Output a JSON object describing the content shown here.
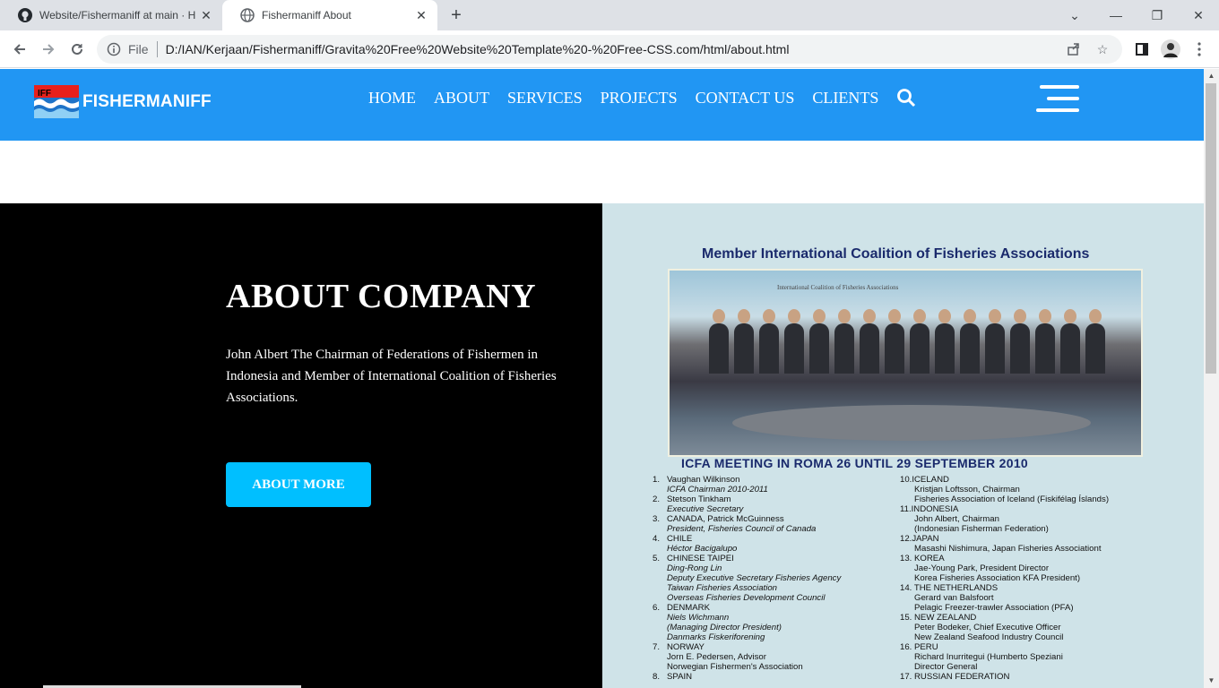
{
  "browser": {
    "tabs": [
      {
        "title": "Website/Fishermaniff at main · H",
        "active": false,
        "icon": "github-icon"
      },
      {
        "title": "Fishermaniff About",
        "active": true,
        "icon": "globe-icon"
      }
    ],
    "scheme_label": "File",
    "url": "D:/IAN/Kerjaan/Fishermaniff/Gravita%20Free%20Website%20Template%20-%20Free-CSS.com/html/about.html"
  },
  "site": {
    "brand": "FISHERMANIFF",
    "brand_colors": {
      "header": "#2196f3",
      "button": "#00bfff"
    },
    "nav": [
      "HOME",
      "ABOUT",
      "SERVICES",
      "PROJECTS",
      "CONTACT US",
      "CLIENTS"
    ]
  },
  "about": {
    "title": "ABOUT COMPANY",
    "text": "John Albert The Chairman of Federations of Fishermen in Indonesia and Member of International Coalition of Fisheries Associations.",
    "button": "ABOUT MORE"
  },
  "document": {
    "title": "Member International Coalition of Fisheries Associations",
    "banner": "International Coalition of Fisheries Associations",
    "subtitle": "ICFA MEETING IN ROMA 26 UNTIL 29 SEPTEMBER 2010",
    "left_col": [
      "1.   Vaughan Wilkinson",
      "      ICFA Chairman 2010-2011",
      "2.   Stetson Tinkham",
      "      Executive Secretary",
      "3.   CANADA, Patrick McGuinness",
      "      President, Fisheries Council of Canada",
      "4.   CHILE",
      "      Héctor Bacigalupo",
      "5.   CHINESE TAIPEI",
      "      Ding-Rong Lin",
      "      Deputy Executive Secretary Fisheries Agency",
      "      Taiwan Fisheries Association",
      "      Overseas Fisheries Development Council",
      "6.   DENMARK",
      "      Niels Wichmann",
      "      (Managing Director President)",
      "      Danmarks Fiskeriforening",
      "7.   NORWAY",
      "      Jorn E. Pedersen, Advisor",
      "      Norwegian Fishermen's Association",
      "8.   SPAIN"
    ],
    "right_col": [
      "10.ICELAND",
      "      Kristjan Loftsson, Chairman",
      "      Fisheries Association of Iceland (Fiskifélag Íslands)",
      "11.INDONESIA",
      "      John Albert, Chairman",
      "      (Indonesian Fisherman Federation)",
      "12.JAPAN",
      "      Masashi Nishimura, Japan Fisheries Associationt",
      "13. KOREA",
      "      Jae-Young Park, President Director",
      "      Korea Fisheries Association KFA President)",
      "14. THE NETHERLANDS",
      "      Gerard van Balsfoort",
      "      Pelagic Freezer-trawler Association (PFA)",
      "15. NEW ZEALAND",
      "      Peter Bodeker, Chief Executive Officer",
      "      New Zealand Seafood Industry Council",
      "16. PERU",
      "      Richard Inurritegui (Humberto Speziani",
      "      Director General",
      "17. RUSSIAN FEDERATION"
    ]
  }
}
